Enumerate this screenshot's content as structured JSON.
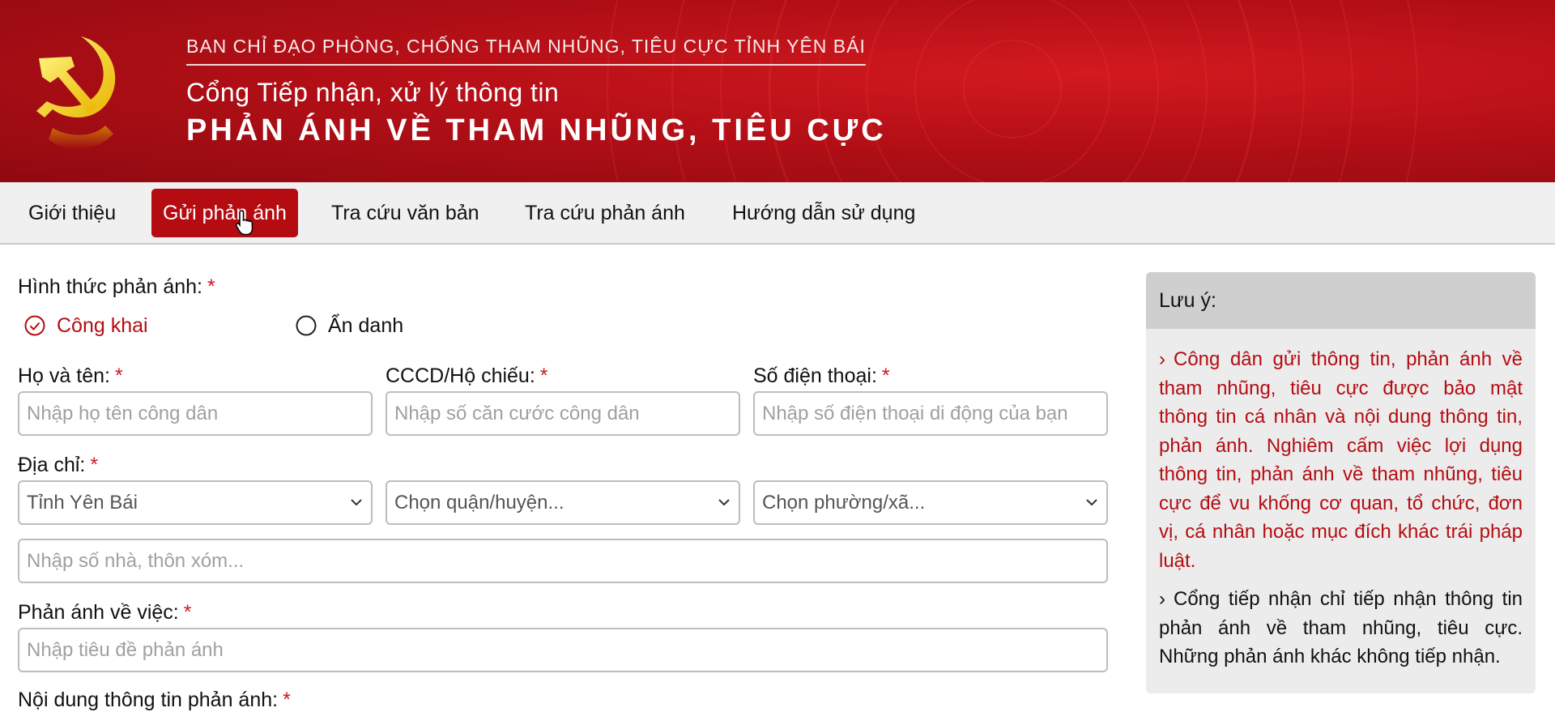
{
  "header": {
    "supertitle": "BAN CHỈ ĐẠO PHÒNG, CHỐNG THAM NHŨNG, TIÊU CỰC TỈNH YÊN BÁI",
    "title_line1": "Cổng Tiếp nhận, xử lý thông tin",
    "title_line2": "PHẢN ÁNH VỀ THAM NHŨNG, TIÊU CỰC",
    "logo_icon": "hammer-sickle-icon"
  },
  "nav": {
    "items": [
      {
        "label": "Giới thiệu"
      },
      {
        "label": "Gửi phản ánh",
        "active": true
      },
      {
        "label": "Tra cứu văn bản"
      },
      {
        "label": "Tra cứu phản ánh"
      },
      {
        "label": "Hướng dẫn sử dụng"
      }
    ]
  },
  "form": {
    "type_label": "Hình thức phản ánh:",
    "required_mark": "*",
    "type_options": [
      {
        "label": "Công khai",
        "checked": true
      },
      {
        "label": "Ẩn danh",
        "checked": false
      }
    ],
    "name_label": "Họ và tên:",
    "name_placeholder": "Nhập họ tên công dân",
    "id_label": "CCCD/Hộ chiếu:",
    "id_placeholder": "Nhập số căn cước công dân",
    "phone_label": "Số điện thoại:",
    "phone_placeholder": "Nhập số điện thoại di động của bạn",
    "address_label": "Địa chỉ:",
    "province_value": "Tỉnh Yên Bái",
    "district_value": "Chọn quận/huyện...",
    "ward_value": "Chọn phường/xã...",
    "street_placeholder": "Nhập số nhà, thôn xóm...",
    "subject_label": "Phản ánh về việc:",
    "subject_placeholder": "Nhập tiêu đề phản ánh",
    "content_label": "Nội dung thông tin phản ánh:"
  },
  "note": {
    "title": "Lưu ý:",
    "item1": "Công dân gửi thông tin, phản ánh về tham nhũng, tiêu cực được bảo mật thông tin cá nhân và nội dung thông tin, phản ánh. Nghiêm cấm việc lợi dụng thông tin, phản ánh về tham nhũng, tiêu cực để vu khống cơ quan, tổ chức, đơn vị, cá nhân hoặc mục đích khác trái pháp luật.",
    "item2": "Cổng tiếp nhận chỉ tiếp nhận thông tin phản ánh về tham nhũng, tiêu cực. Những phản ánh khác không tiếp nhận.",
    "bullet": "›"
  },
  "colors": {
    "brand_red": "#b50c12",
    "required_red": "#d0161e",
    "logo_yellow": "#f5d21a"
  }
}
